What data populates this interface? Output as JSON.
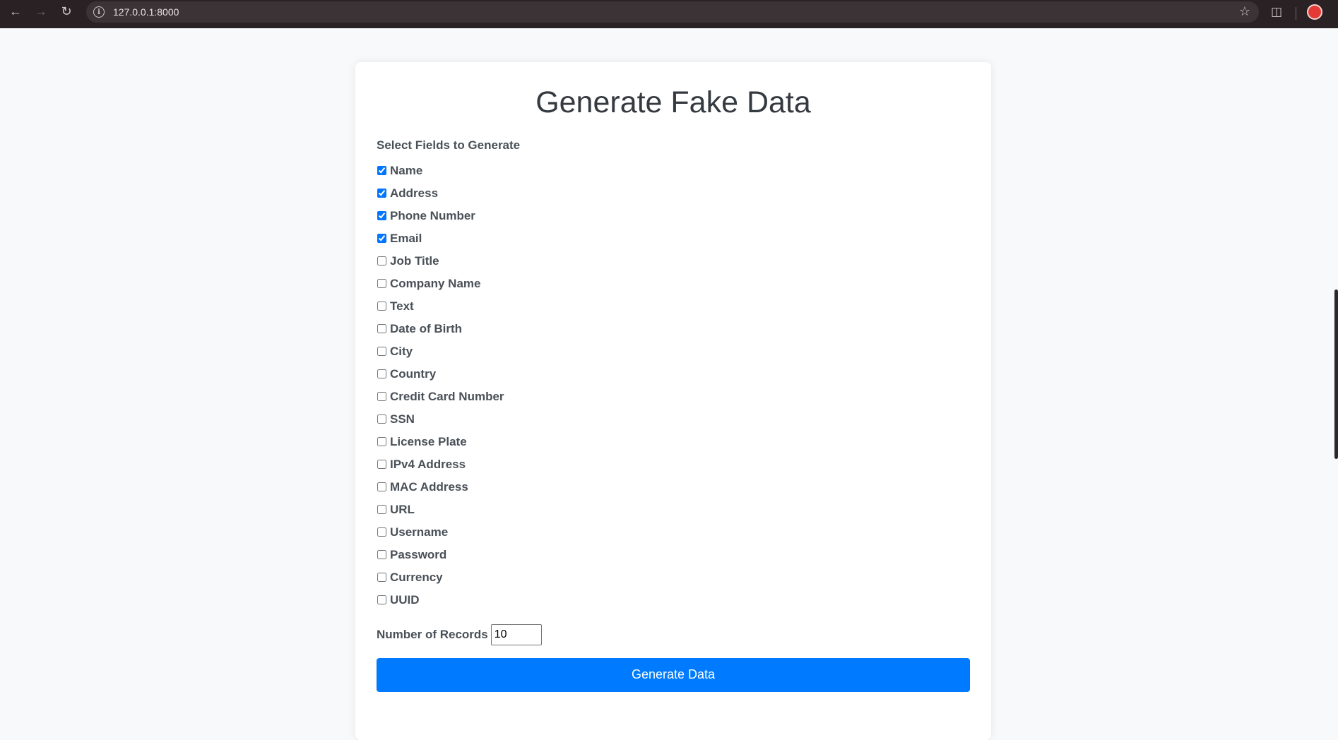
{
  "browser": {
    "url": "127.0.0.1:8000",
    "back_icon": "arrow-left-icon",
    "forward_icon": "arrow-right-icon",
    "reload_icon": "reload-icon",
    "star_icon": "star-icon",
    "extensions_icon": "puzzle-icon"
  },
  "page": {
    "title": "Generate Fake Data",
    "section_label": "Select Fields to Generate",
    "fields": [
      {
        "label": "Name",
        "checked": true
      },
      {
        "label": "Address",
        "checked": true
      },
      {
        "label": "Phone Number",
        "checked": true
      },
      {
        "label": "Email",
        "checked": true
      },
      {
        "label": "Job Title",
        "checked": false
      },
      {
        "label": "Company Name",
        "checked": false
      },
      {
        "label": "Text",
        "checked": false
      },
      {
        "label": "Date of Birth",
        "checked": false
      },
      {
        "label": "City",
        "checked": false
      },
      {
        "label": "Country",
        "checked": false
      },
      {
        "label": "Credit Card Number",
        "checked": false
      },
      {
        "label": "SSN",
        "checked": false
      },
      {
        "label": "License Plate",
        "checked": false
      },
      {
        "label": "IPv4 Address",
        "checked": false
      },
      {
        "label": "MAC Address",
        "checked": false
      },
      {
        "label": "URL",
        "checked": false
      },
      {
        "label": "Username",
        "checked": false
      },
      {
        "label": "Password",
        "checked": false
      },
      {
        "label": "Currency",
        "checked": false
      },
      {
        "label": "UUID",
        "checked": false
      }
    ],
    "records_label": "Number of Records",
    "records_value": "10",
    "generate_button": "Generate Data"
  },
  "colors": {
    "primary": "#007bff",
    "checkbox_accent": "#0075ff",
    "page_bg": "#f8f9fa",
    "chrome_bg": "#2a2124"
  }
}
